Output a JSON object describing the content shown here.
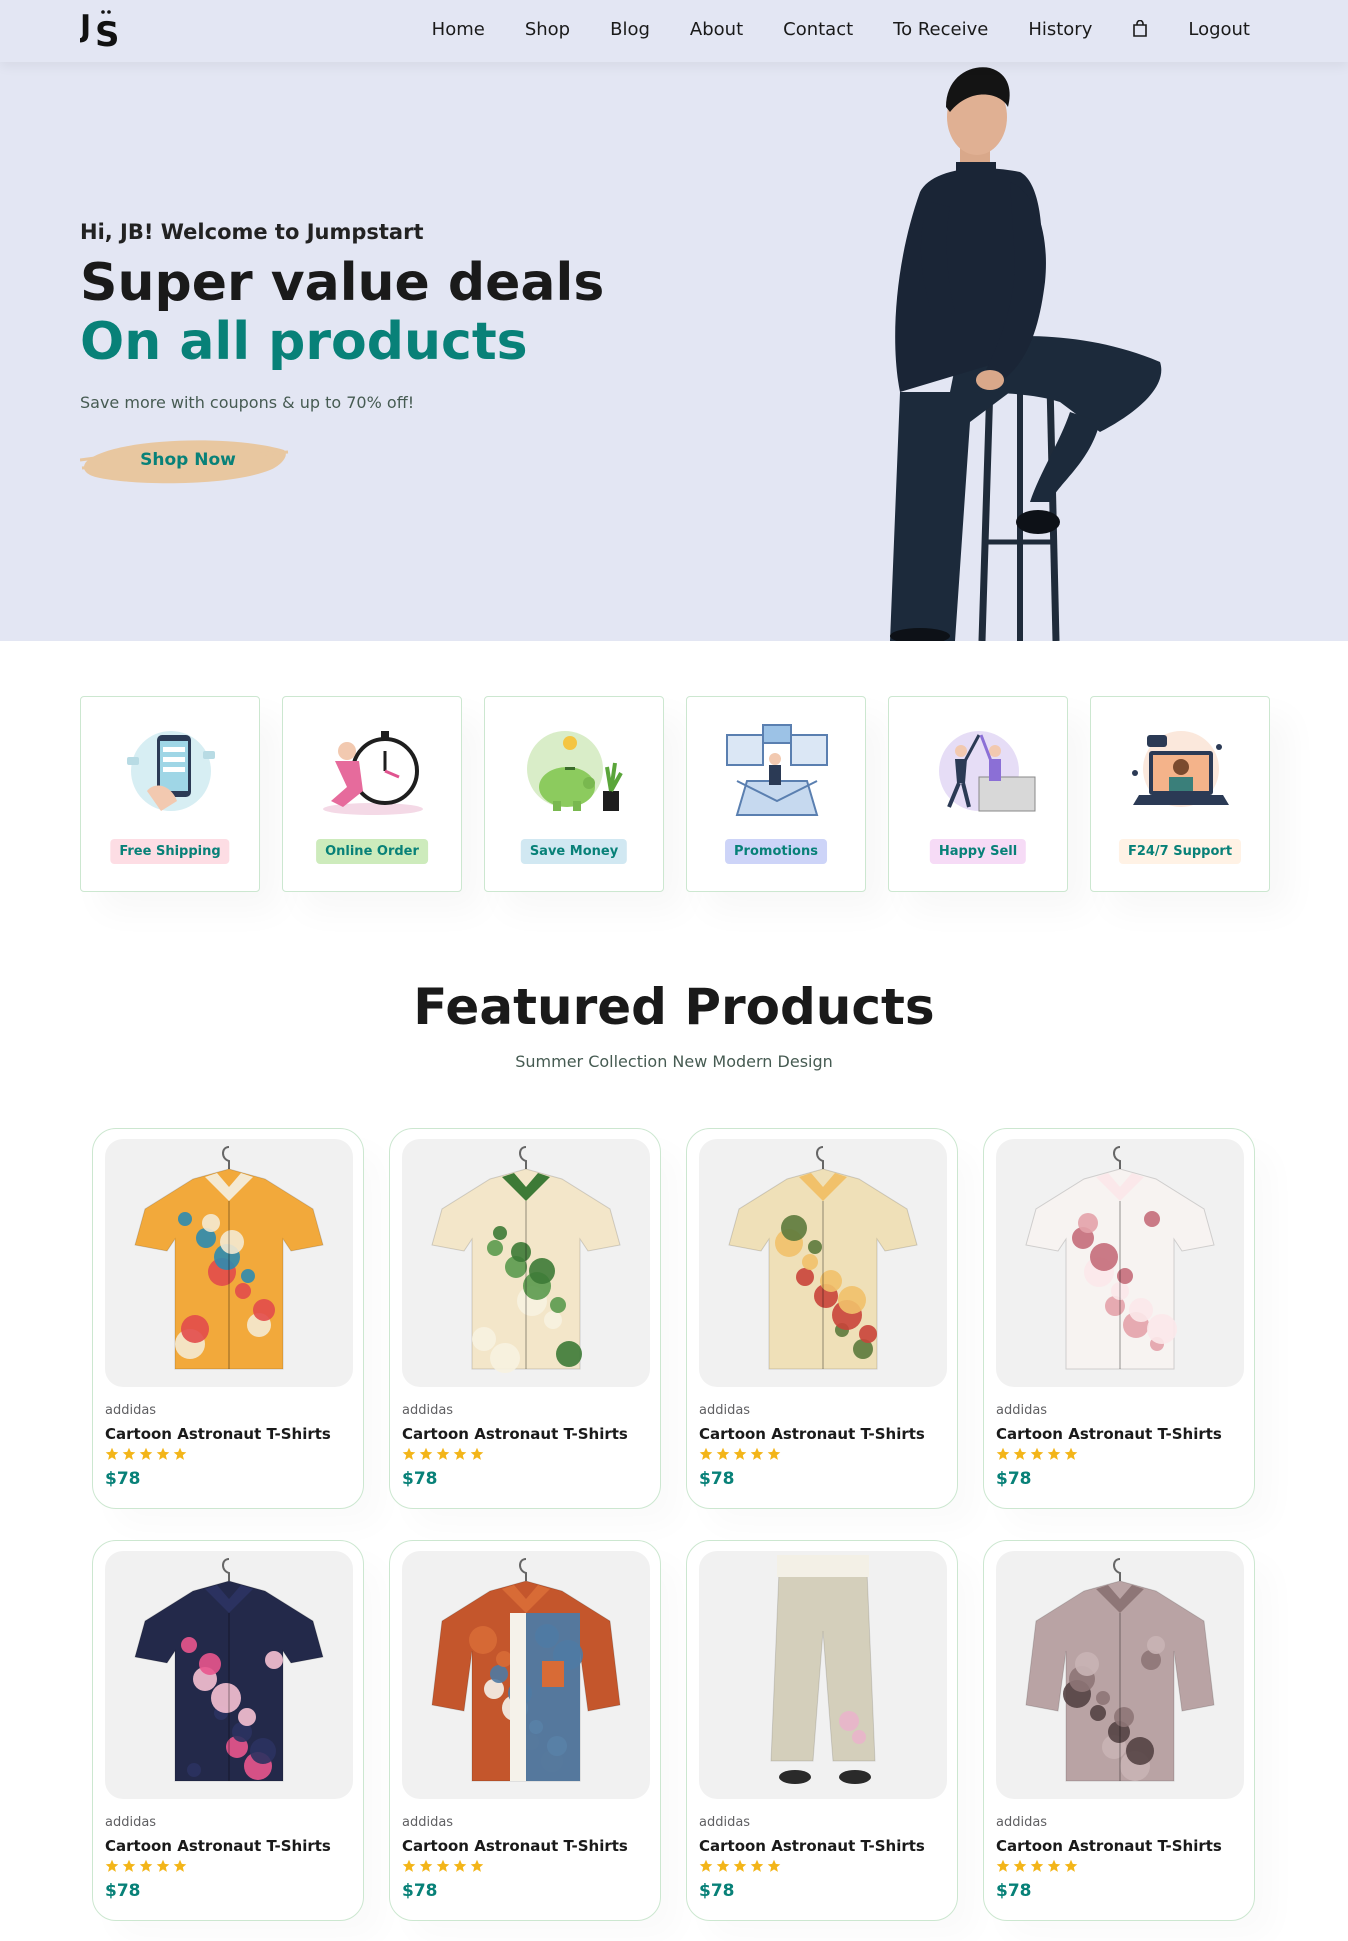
{
  "nav": {
    "logo": "JS",
    "items": [
      "Home",
      "Shop",
      "Blog",
      "About",
      "Contact",
      "To Receive",
      "History"
    ],
    "logout": "Logout"
  },
  "hero": {
    "greeting": "Hi, JB! Welcome to Jumpstart",
    "title_line1": "Super value deals",
    "title_line2": "On all products",
    "subtitle": "Save more with coupons & up to 70% off!",
    "button": "Shop Now"
  },
  "features": [
    {
      "label": "Free Shipping",
      "bg": "#fddde4",
      "fg": "#088178"
    },
    {
      "label": "Online Order",
      "bg": "#cdebbc",
      "fg": "#088178"
    },
    {
      "label": "Save Money",
      "bg": "#d1e8f2",
      "fg": "#088178"
    },
    {
      "label": "Promotions",
      "bg": "#cdd4f8",
      "fg": "#088178"
    },
    {
      "label": "Happy Sell",
      "bg": "#f6dbf6",
      "fg": "#088178"
    },
    {
      "label": "F24/7 Support",
      "bg": "#fff2e5",
      "fg": "#088178"
    }
  ],
  "featured": {
    "title": "Featured Products",
    "subtitle": "Summer Collection New Modern Design"
  },
  "products": [
    {
      "brand": "addidas",
      "name": "Cartoon Astronaut T-Shirts",
      "rating": 5,
      "price": "$78"
    },
    {
      "brand": "addidas",
      "name": "Cartoon Astronaut T-Shirts",
      "rating": 5,
      "price": "$78"
    },
    {
      "brand": "addidas",
      "name": "Cartoon Astronaut T-Shirts",
      "rating": 5,
      "price": "$78"
    },
    {
      "brand": "addidas",
      "name": "Cartoon Astronaut T-Shirts",
      "rating": 5,
      "price": "$78"
    },
    {
      "brand": "addidas",
      "name": "Cartoon Astronaut T-Shirts",
      "rating": 5,
      "price": "$78"
    },
    {
      "brand": "addidas",
      "name": "Cartoon Astronaut T-Shirts",
      "rating": 5,
      "price": "$78"
    },
    {
      "brand": "addidas",
      "name": "Cartoon Astronaut T-Shirts",
      "rating": 5,
      "price": "$78"
    },
    {
      "brand": "addidas",
      "name": "Cartoon Astronaut T-Shirts",
      "rating": 5,
      "price": "$78"
    }
  ],
  "colors": {
    "accent": "#088178",
    "hero_bg": "#e3e6f3",
    "star": "#f3b519",
    "button_brush": "#e8c7a0"
  }
}
